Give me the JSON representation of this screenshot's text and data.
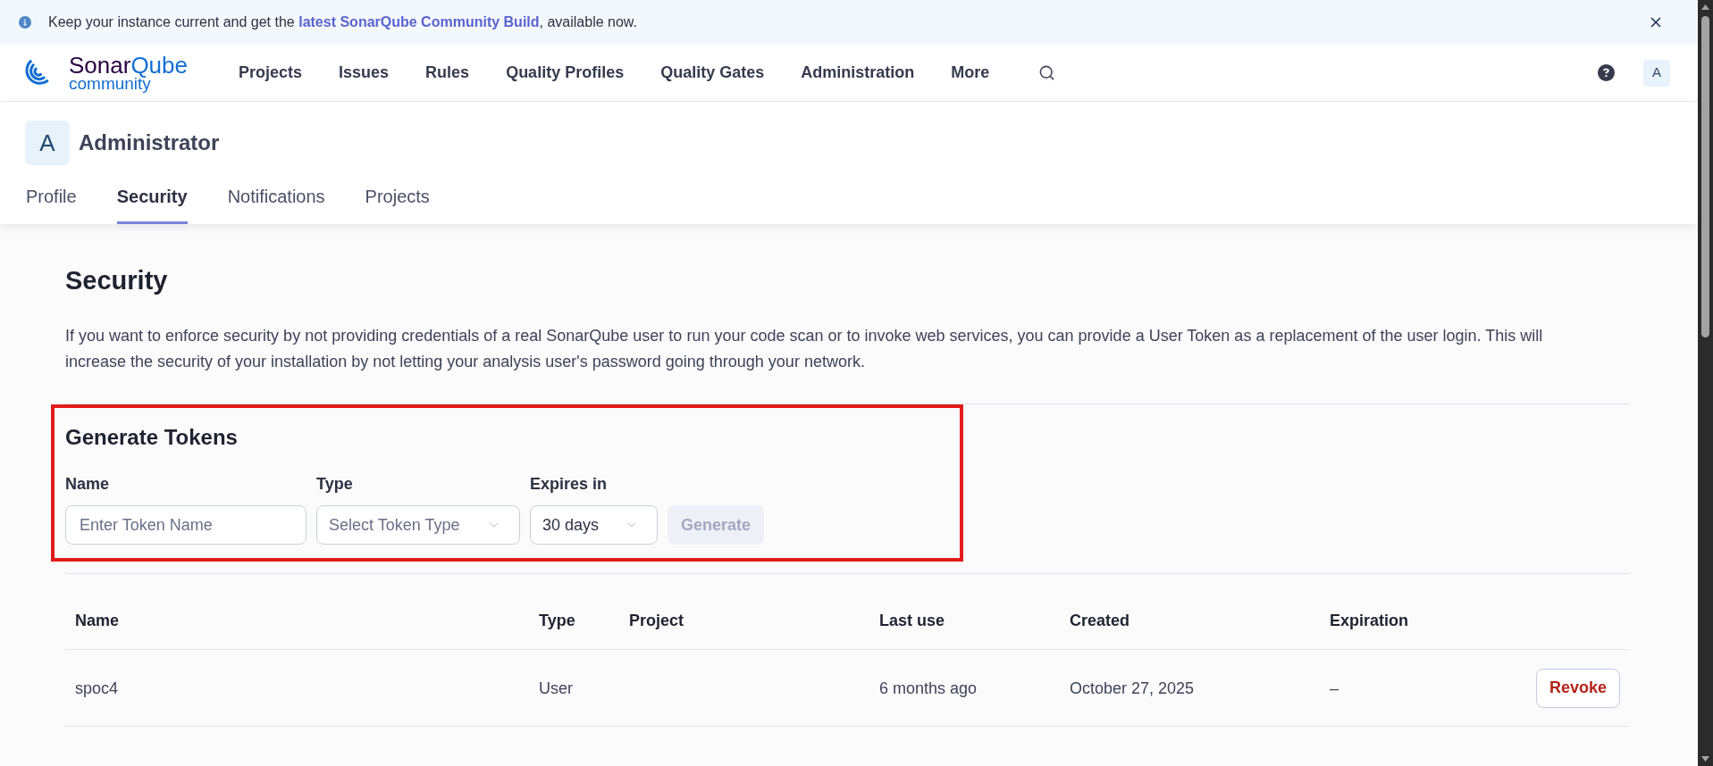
{
  "banner": {
    "text_before": "Keep your instance current and get the ",
    "link": "latest SonarQube Community Build",
    "text_after": ", available now."
  },
  "nav": {
    "logo": {
      "wordmark": [
        "Sonar",
        "Qube"
      ],
      "edition": "community"
    },
    "items": [
      "Projects",
      "Issues",
      "Rules",
      "Quality Profiles",
      "Quality Gates",
      "Administration",
      "More"
    ],
    "avatar": "A"
  },
  "profile": {
    "avatar": "A",
    "name": "Administrator",
    "tabs": [
      {
        "label": "Profile",
        "selected": false
      },
      {
        "label": "Security",
        "selected": true
      },
      {
        "label": "Notifications",
        "selected": false
      },
      {
        "label": "Projects",
        "selected": false
      }
    ]
  },
  "security": {
    "title": "Security",
    "description": "If you want to enforce security by not providing credentials of a real SonarQube user to run your code scan or to invoke web services, you can provide a User Token as a replacement of the user login. This will increase the security of your installation by not letting your analysis user's password going through your network."
  },
  "generate_tokens": {
    "title": "Generate Tokens",
    "fields": [
      {
        "kind": "text",
        "label": "Name",
        "placeholder": "Enter Token Name"
      },
      {
        "kind": "select",
        "label": "Type",
        "placeholder": "Select Token Type"
      },
      {
        "kind": "select",
        "label": "Expires in",
        "value": "30 days"
      }
    ],
    "button": {
      "label": "Generate",
      "disabled": true
    }
  },
  "tokens_table": {
    "columns": [
      "Name",
      "Type",
      "Project",
      "Last use",
      "Created",
      "Expiration"
    ],
    "rows": [
      {
        "name": "spoc4",
        "type": "User",
        "last_use": "6 months ago",
        "created": "October 27, 2025",
        "expiration": "–",
        "action": "Revoke"
      }
    ]
  }
}
